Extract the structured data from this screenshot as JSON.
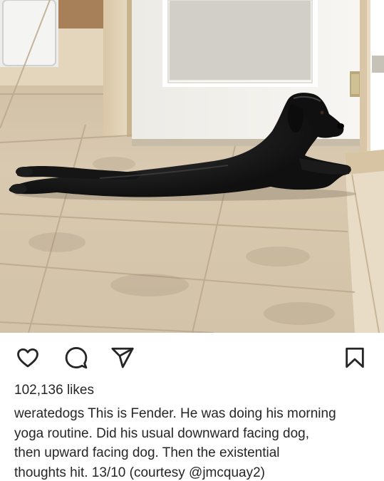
{
  "post": {
    "image_alt": "Black dog stretched out flat on a tiled floor beside a doorway",
    "likes_text": "102,136 likes",
    "caption": {
      "username": "weratedogs",
      "line1_rest": " This is Fender. He was doing his morning",
      "line2": "yoga routine. Did his usual downward facing dog,",
      "line3": "then upward facing dog. Then the existential",
      "line4_before_mention": "thoughts hit. 13/10 (courtesy ",
      "mention": "@jmcquay2",
      "line4_after_mention": ")"
    }
  },
  "actions": [
    {
      "id": "like",
      "icon": "heart-outline-icon"
    },
    {
      "id": "comment",
      "icon": "speech-bubble-icon"
    },
    {
      "id": "share",
      "icon": "paper-plane-icon"
    },
    {
      "id": "save",
      "icon": "bookmark-icon"
    }
  ],
  "colors": {
    "text": "#262626",
    "background": "#ffffff",
    "floor_tile": "#d6c7ae",
    "grout": "#b9a88f",
    "door": "#f1efea",
    "dog": "#141414"
  }
}
